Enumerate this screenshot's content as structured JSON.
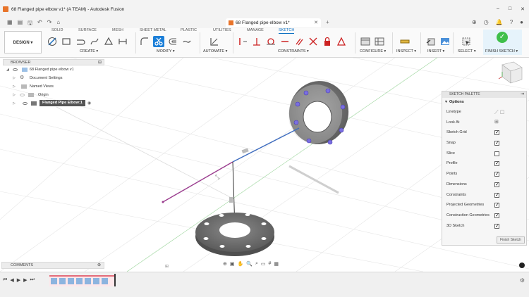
{
  "window": {
    "title": "68 Flanged pipe elbow v1* (A TEAM) - Autodesk Fusion",
    "controls": [
      "–",
      "□",
      "✕"
    ]
  },
  "document_tab": {
    "label": "68 Flanged pipe elbow v1*"
  },
  "ribbon": {
    "workspace": "DESIGN ▾",
    "tabs": [
      "SOLID",
      "SURFACE",
      "MESH",
      "SHEET METAL",
      "PLASTIC",
      "UTILITIES",
      "MANAGE",
      "SKETCH"
    ],
    "active_tab": "SKETCH",
    "groups": [
      "CREATE ▾",
      "MODIFY ▾",
      "AUTOMATE ▾",
      "CONSTRAINTS ▾",
      "CONFIGURE ▾",
      "INSPECT ▾",
      "INSERT ▾",
      "SELECT ▾"
    ],
    "finish_label": "FINISH SKETCH ▾"
  },
  "browser": {
    "title": "BROWSER",
    "items": [
      {
        "label": "68 Flanged pipe elbow v1"
      },
      {
        "label": "Document Settings"
      },
      {
        "label": "Named Views"
      },
      {
        "label": "Origin"
      },
      {
        "label": "Flanged Pipe Elbow:1"
      }
    ]
  },
  "palette": {
    "title": "SKETCH PALETTE",
    "section": "Options",
    "options": [
      {
        "label": "Linetype",
        "kind": "linetype"
      },
      {
        "label": "Look At",
        "kind": "lookat"
      },
      {
        "label": "Sketch Grid",
        "checked": true
      },
      {
        "label": "Snap",
        "checked": true
      },
      {
        "label": "Slice",
        "checked": false
      },
      {
        "label": "Profile",
        "checked": true
      },
      {
        "label": "Points",
        "checked": true
      },
      {
        "label": "Dimensions",
        "checked": true
      },
      {
        "label": "Constraints",
        "checked": true
      },
      {
        "label": "Projected Geometries",
        "checked": true
      },
      {
        "label": "Construction Geometries",
        "checked": true
      },
      {
        "label": "3D Sketch",
        "checked": true
      }
    ],
    "finish_button": "Finish Sketch"
  },
  "comments": {
    "title": "COMMENTS"
  },
  "colors": {
    "accent": "#1c7fd8",
    "finish_green": "#3fbf4a",
    "timeline": "#e36c7a"
  }
}
